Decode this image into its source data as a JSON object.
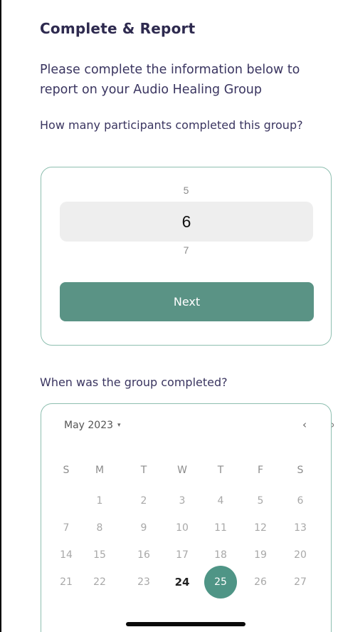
{
  "title": "Complete & Report",
  "intro": "Please complete the information below to report on your Audio Healing Group",
  "participants": {
    "question": "How many participants completed this group?",
    "picker_prev": "5",
    "picker_selected": "6",
    "picker_next": "7",
    "next_label": "Next"
  },
  "completion": {
    "question": "When was the group completed?",
    "month_label": "May 2023",
    "month_caret": "▾",
    "prev_arrow": "‹",
    "next_arrow": "›",
    "weekdays": [
      "S",
      "M",
      "T",
      "W",
      "T",
      "F",
      "S"
    ],
    "weeks": [
      [
        "",
        "1",
        "2",
        "3",
        "4",
        "5",
        "6"
      ],
      [
        "7",
        "8",
        "9",
        "10",
        "11",
        "12",
        "13"
      ],
      [
        "14",
        "15",
        "16",
        "17",
        "18",
        "19",
        "20"
      ],
      [
        "21",
        "22",
        "23",
        "24",
        "25",
        "26",
        "27"
      ]
    ],
    "today": "24",
    "selected": "25"
  },
  "colors": {
    "accent": "#5a9385",
    "selected_day": "#4f9586",
    "card_border": "#8ebfb0",
    "heading": "#2e2a4f"
  }
}
